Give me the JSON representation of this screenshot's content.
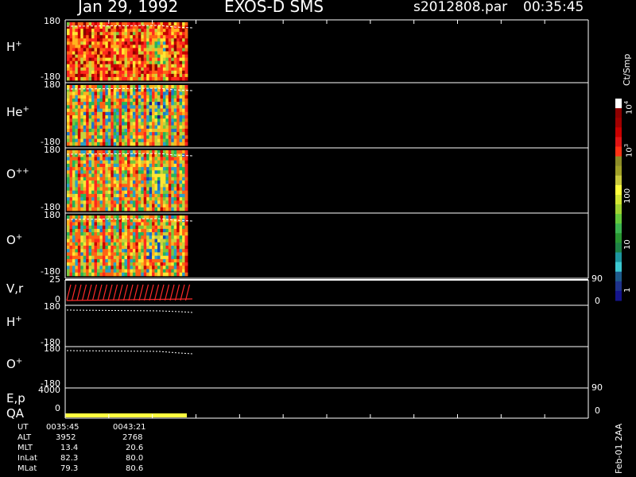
{
  "header": {
    "date": "Jan 29, 1992",
    "mission": "EXOS-D SMS",
    "file": "s2012808.par",
    "time": "00:35:45"
  },
  "panels": [
    {
      "label": "H",
      "sup": "+",
      "top": "180",
      "bottom": "-180"
    },
    {
      "label": "He",
      "sup": "+",
      "top": "180",
      "bottom": "-180"
    },
    {
      "label": "O",
      "sup": "++",
      "top": "180",
      "bottom": "-180"
    },
    {
      "label": "O",
      "sup": "+",
      "top": "180",
      "bottom": "-180"
    },
    {
      "label": "V,r",
      "sup": "",
      "top": "25",
      "bottom": "0",
      "right_top": "90",
      "right_bottom": "0"
    },
    {
      "label": "H",
      "sup": "+",
      "top": "180",
      "bottom": "-180"
    },
    {
      "label": "O",
      "sup": "+",
      "top": "180",
      "bottom": "-180"
    },
    {
      "label": "E,p",
      "sup": "",
      "top": "4000",
      "bottom": "0",
      "right_top": "90",
      "right_bottom": "0"
    },
    {
      "label": "QA",
      "sup": "",
      "top": "",
      "bottom": ""
    }
  ],
  "colorbar": {
    "title": "Ct/Smp",
    "labels": [
      "10^4",
      "10^3",
      "100",
      "10",
      "1"
    ]
  },
  "footer": {
    "rows": [
      {
        "name": "UT",
        "v1": "0035:45",
        "v2": "0043:21"
      },
      {
        "name": "ALT",
        "v1": "3952",
        "v2": "2768"
      },
      {
        "name": "MLT",
        "v1": "13.4",
        "v2": "20.6"
      },
      {
        "name": "InLat",
        "v1": "82.3",
        "v2": "80.0"
      },
      {
        "name": "MLat",
        "v1": "79.3",
        "v2": "80.6"
      }
    ],
    "stamp": "Feb-01 2AA"
  },
  "colors": {
    "axis": "#ffffff",
    "qa_bar": "#ffff3f",
    "vr_red": "#ff2a2a"
  },
  "chart_data": {
    "type": "heatmap",
    "title": "Jan 29, 1992   EXOS-D SMS",
    "xlabel": "UT",
    "x_range": [
      "0035:45",
      "0043:21"
    ],
    "ylim": [
      -180,
      180
    ],
    "colorscale_label": "Ct/Smp",
    "colorscale_ticks": [
      "1",
      "10",
      "100",
      "10^3",
      "10^4"
    ]
  }
}
